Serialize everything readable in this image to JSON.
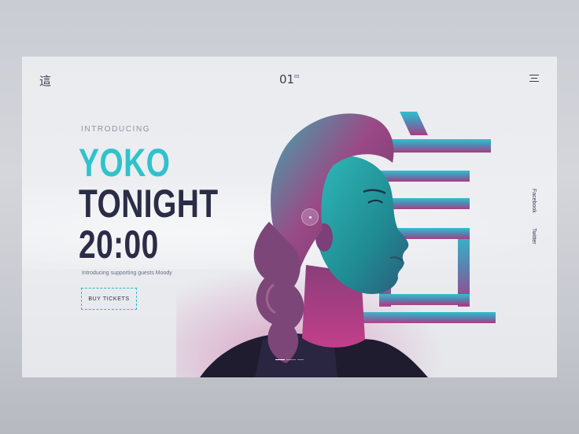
{
  "header": {
    "logo_glyph": "這",
    "slide_current": "01",
    "slide_total": "03"
  },
  "hero": {
    "eyebrow": "INTRODUCING",
    "line1": "YOKO",
    "line2": "TONIGHT",
    "line3": "20:00",
    "subtitle": "Introducing supporting guests Moody",
    "cta_label": "BUY TICKETS"
  },
  "social": [
    "Facebook",
    "Twitter"
  ],
  "icons": {
    "menu": "menu-icon",
    "play": "play-icon",
    "background_glyph": "這"
  },
  "colors": {
    "accent": "#30c2cc",
    "dark_text": "#2b2d47",
    "glyph_top": "#2ec0cc",
    "glyph_bottom": "#a83d84",
    "duotone_magenta": "#b3387e",
    "duotone_teal": "#35c5c2"
  },
  "slider": {
    "count": 3,
    "active_index": 0
  }
}
